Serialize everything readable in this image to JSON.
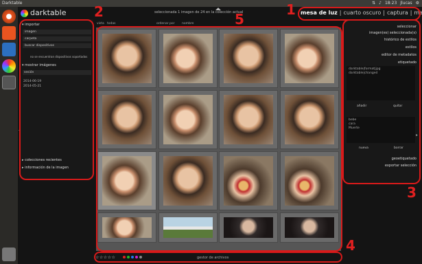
{
  "os": {
    "window_title": "Darktable",
    "clock": "18:23",
    "user": "Jlucas"
  },
  "app": {
    "logo_text": "darktable",
    "subtitle": "seleccionada 1 imagen de 24 en la colección actual",
    "views": [
      "mesa de luz",
      "|",
      "cuarto oscuro",
      "|",
      "captura",
      "|",
      "mapa"
    ]
  },
  "annotations": [
    "1",
    "2",
    "3",
    "4",
    "5"
  ],
  "left_panel": {
    "import_title": "importar",
    "buttons": [
      "imagen",
      "carpeta",
      "buscar dispositivos"
    ],
    "no_devices": "no se encuentran dispositivos soportados",
    "collect_title": "mostrar imágenes",
    "collect_field": "sesión",
    "dates": [
      "2014-06-19",
      "2014-05-21"
    ],
    "recent_title": "colecciones recientes",
    "info_title": "información de la imagen"
  },
  "filter_bar": {
    "view_label": "vista",
    "view_value": "todas",
    "sort_label": "ordenar por",
    "sort_value": "nombre"
  },
  "grid": {
    "thumbs": [
      "baby",
      "baby2",
      "baby",
      "baby2",
      "baby",
      "baby2",
      "baby",
      "baby",
      "baby2",
      "baby",
      "toy",
      "toy",
      "baby2",
      "outdoor",
      "dark",
      "dark"
    ]
  },
  "right_panel": {
    "select_title": "seleccionar",
    "selected_title": "imagen(es) seleccionada(s)",
    "history_title": "histórico de estilos",
    "styles_title": "estilos",
    "metadata_title": "editor de metadatos",
    "tagging_title": "etiquetado",
    "attached_tags": [
      "darktable|format|jpg",
      "darktable|changed"
    ],
    "attach_label": "añadir",
    "detach_label": "quitar",
    "dictionary_tags": [
      "bebe",
      "cara",
      "Muerte"
    ],
    "new_label": "nueva",
    "delete_label": "borrar",
    "geotag_title": "geoetiquetado",
    "export_title": "exportar selección"
  },
  "bottom_bar": {
    "stars": "☆☆☆☆☆",
    "color_labels": [
      "#d22",
      "#2b2",
      "#27e",
      "#c2c",
      "#888"
    ],
    "filemanager": "gestor de archivos"
  }
}
